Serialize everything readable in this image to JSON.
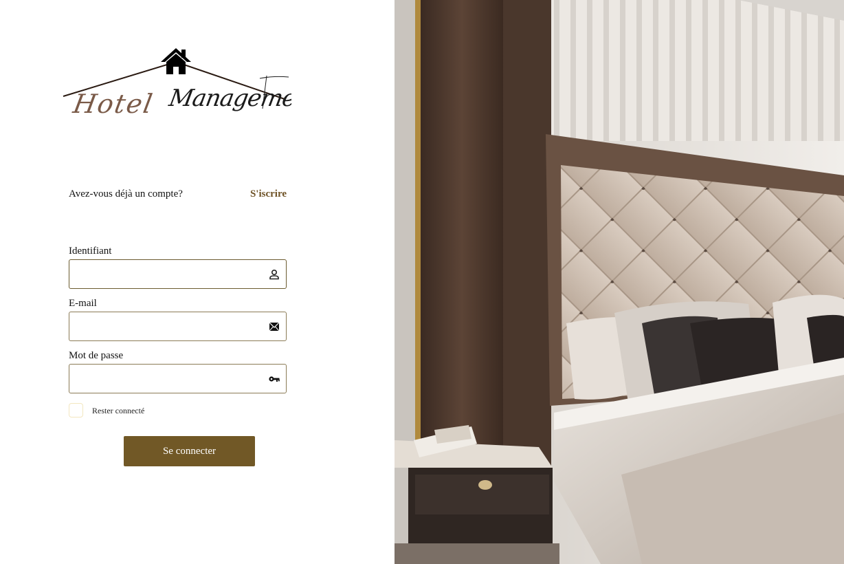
{
  "logo": {
    "text_line1": "Hotel",
    "text_line2": "Management",
    "color": "#3a2418",
    "accent": "#6e4a3c"
  },
  "account": {
    "question": "Avez-vous déjà un compte?",
    "signup_label": "S'iscrire"
  },
  "fields": {
    "username": {
      "label": "Identifiant",
      "value": "",
      "icon": "person-icon"
    },
    "email": {
      "label": "E-mail",
      "value": "",
      "icon": "envelope-icon"
    },
    "password": {
      "label": "Mot de passe",
      "value": "",
      "icon": "key-icon"
    }
  },
  "remember": {
    "label": "Rester connecté",
    "checked": false
  },
  "login_button": {
    "label": "Se connecter"
  },
  "colors": {
    "brand": "#715826",
    "link": "#6e5226",
    "field_border": "#8a7a55",
    "checkbox_border": "#f3e7bf"
  },
  "photo": {
    "subject": "hotel-bedroom-photo"
  }
}
